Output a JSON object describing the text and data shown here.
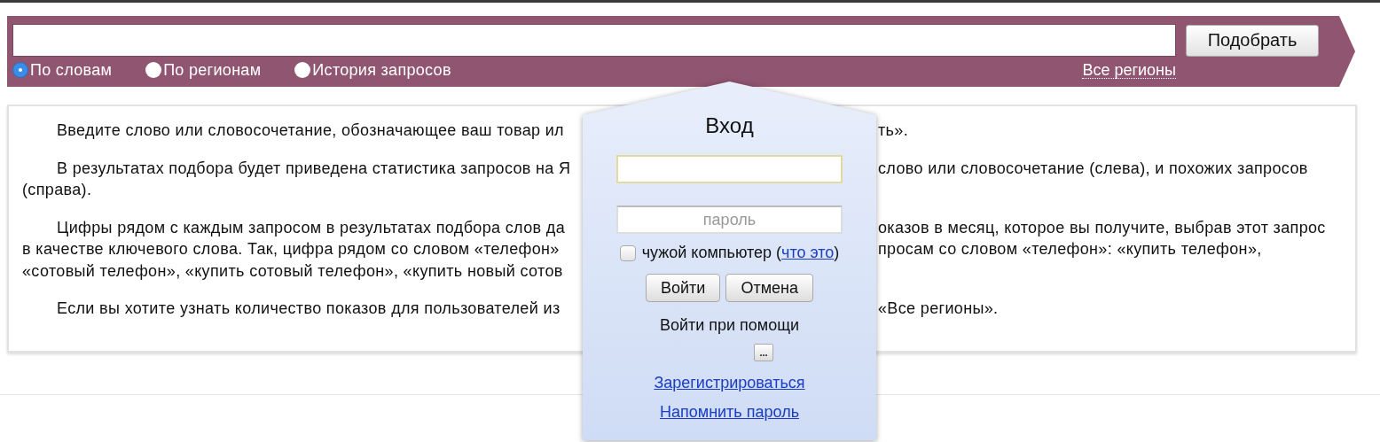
{
  "search": {
    "submit_label": "Подобрать",
    "modes": [
      {
        "label": "По словам",
        "selected": true
      },
      {
        "label": "По регионам",
        "selected": false
      },
      {
        "label": "История запросов",
        "selected": false
      }
    ],
    "region_link": "Все регионы"
  },
  "info": {
    "paragraphs": [
      {
        "lines": [
          {
            "left": "Введите слово или словосочетание, обозначающее ваш товар ил",
            "right": "ть»."
          }
        ]
      },
      {
        "lines": [
          {
            "left": "В результатах подбора будет приведена статистика запросов на Я",
            "right": "слово или словосочетание (слева), и похожих запросов"
          },
          {
            "left": "(справа)."
          }
        ]
      },
      {
        "lines": [
          {
            "left": "Цифры рядом с каждым запросом в результатах подбора слов да",
            "right": "оказов в месяц, которое вы получите, выбрав этот запрос"
          },
          {
            "left": "в качестве ключевого слова. Так, цифра рядом со словом «телефон»",
            "right": "просам со словом «телефон»: «купить телефон»,"
          },
          {
            "left": "«сотовый телефон», «купить сотовый телефон», «купить новый сотов"
          }
        ]
      },
      {
        "lines": [
          {
            "left": "Если вы хотите узнать количество показов для пользователей из",
            "right": "«Все регионы»."
          }
        ]
      }
    ]
  },
  "login": {
    "title": "Вход",
    "password_placeholder": "пароль",
    "foreign_computer": {
      "label_before": "чужой компьютер (",
      "link": "что это",
      "label_after": ")",
      "checked": false
    },
    "buttons": [
      "Войти",
      "Отмена"
    ],
    "alt_login_label": "Войти при помощи",
    "more_button": "...",
    "links": [
      "Зарегистрироваться",
      "Напомнить пароль"
    ]
  }
}
